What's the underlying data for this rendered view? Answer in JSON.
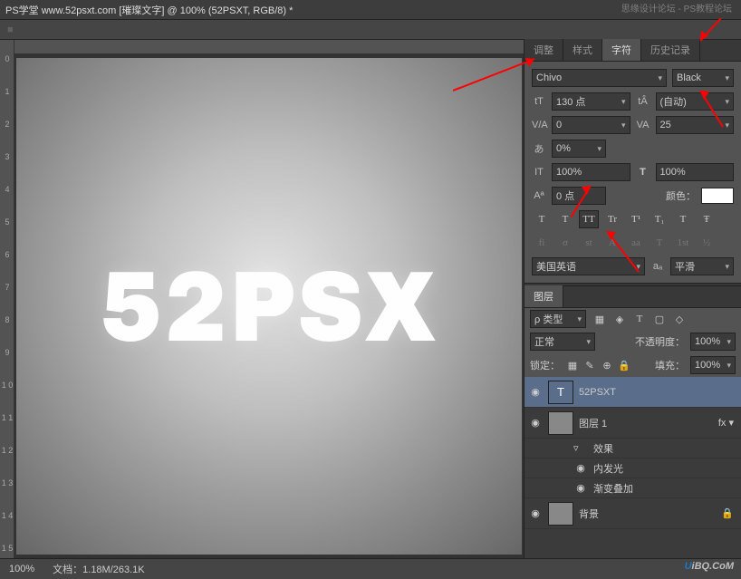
{
  "titlebar": {
    "doc_title": "PS学堂  www.52psxt.com [璀璨文字] @ 100% (52PSXT, RGB/8) *",
    "watermark_right": "思缘设计论坛 - PS教程论坛"
  },
  "canvas": {
    "text": "52PSX"
  },
  "ruler_left": [
    "0",
    "1",
    "2",
    "3",
    "4",
    "5",
    "6",
    "7",
    "8",
    "9",
    "1\n0",
    "1\n1",
    "1\n2",
    "1\n3",
    "1\n4",
    "1\n5"
  ],
  "char_panel": {
    "tabs": [
      "调整",
      "样式",
      "字符",
      "历史记录"
    ],
    "active_tab": "字符",
    "font_family": "Chivo",
    "font_style": "Black",
    "font_size": "130 点",
    "leading": "(自动)",
    "kerning": "0",
    "tracking": "25",
    "tsume": "0%",
    "hscale": "100%",
    "vscale": "100%",
    "baseline": "0 点",
    "color_label": "颜色：",
    "tt_buttons": [
      "T",
      "T",
      "TT",
      "Tr",
      "T¹",
      "T₁",
      "T",
      "Ŧ"
    ],
    "tt_active_index": 2,
    "ot_buttons": [
      "fi",
      "σ",
      "st",
      "A",
      "aa",
      "T",
      "1st",
      "½"
    ],
    "language": "美国英语",
    "aa_label": "aₐ",
    "aa_method": "平滑"
  },
  "layers_panel": {
    "tab": "图层",
    "kind_label": "ρ 类型",
    "kind_icons": [
      "▦",
      "◈",
      "T",
      "▢",
      "◇"
    ],
    "blend_mode": "正常",
    "opacity_label": "不透明度：",
    "opacity_value": "100%",
    "lock_label": "锁定：",
    "lock_icons": [
      "▦",
      "✎",
      "⊕",
      "🔒"
    ],
    "fill_label": "填充：",
    "fill_value": "100%",
    "layers": [
      {
        "name": "52PSXT",
        "type": "text",
        "selected": true,
        "visible": true
      },
      {
        "name": "图层 1",
        "type": "raster",
        "visible": true,
        "fx": true,
        "fx_items": [
          "效果",
          "内发光",
          "渐变叠加"
        ]
      },
      {
        "name": "背景",
        "type": "raster",
        "visible": true,
        "locked": true
      }
    ]
  },
  "statusbar": {
    "zoom": "100%",
    "doc_info": "文档：1.18M/263.1K"
  },
  "logo": {
    "a": "U",
    "b": "iBQ.CoM"
  }
}
